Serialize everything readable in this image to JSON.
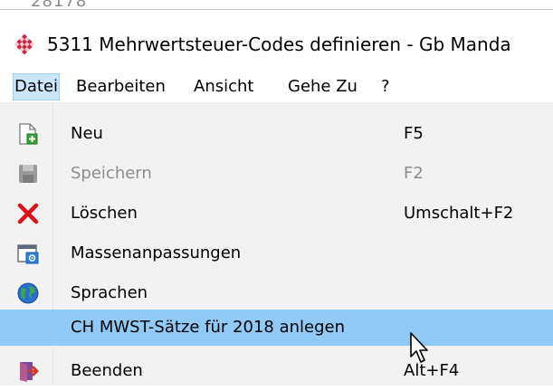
{
  "window": {
    "title": "5311 Mehrwertsteuer-Codes definieren - Gb Manda",
    "background_fragment": "28178"
  },
  "menubar": {
    "items": [
      {
        "label": "Datei",
        "active": true
      },
      {
        "label": "Bearbeiten"
      },
      {
        "label": "Ansicht"
      },
      {
        "label": "Gehe Zu"
      },
      {
        "label": "?"
      }
    ]
  },
  "file_menu": {
    "items": [
      {
        "label": "Neu",
        "shortcut": "F5",
        "icon": "new-document-icon"
      },
      {
        "label": "Speichern",
        "shortcut": "F2",
        "icon": "save-icon",
        "disabled": true
      },
      {
        "label": "Löschen",
        "shortcut": "Umschalt+F2",
        "icon": "delete-x-icon"
      },
      {
        "label": "Massenanpassungen",
        "shortcut": "",
        "icon": "bulk-edit-window-icon"
      },
      {
        "label": "Sprachen",
        "shortcut": "",
        "icon": "globe-icon"
      },
      {
        "label": "CH MWST-Sätze für 2018 anlegen",
        "shortcut": "",
        "icon": "",
        "highlighted": true
      },
      {
        "label": "Beenden",
        "shortcut": "Alt+F4",
        "icon": "exit-door-icon"
      }
    ]
  },
  "colors": {
    "menu_background": "#f2f2f2",
    "highlight": "#91c9f7",
    "active_menu": "#cce8ff",
    "delete_red": "#d9141b",
    "disabled_text": "#8c8c8c"
  }
}
